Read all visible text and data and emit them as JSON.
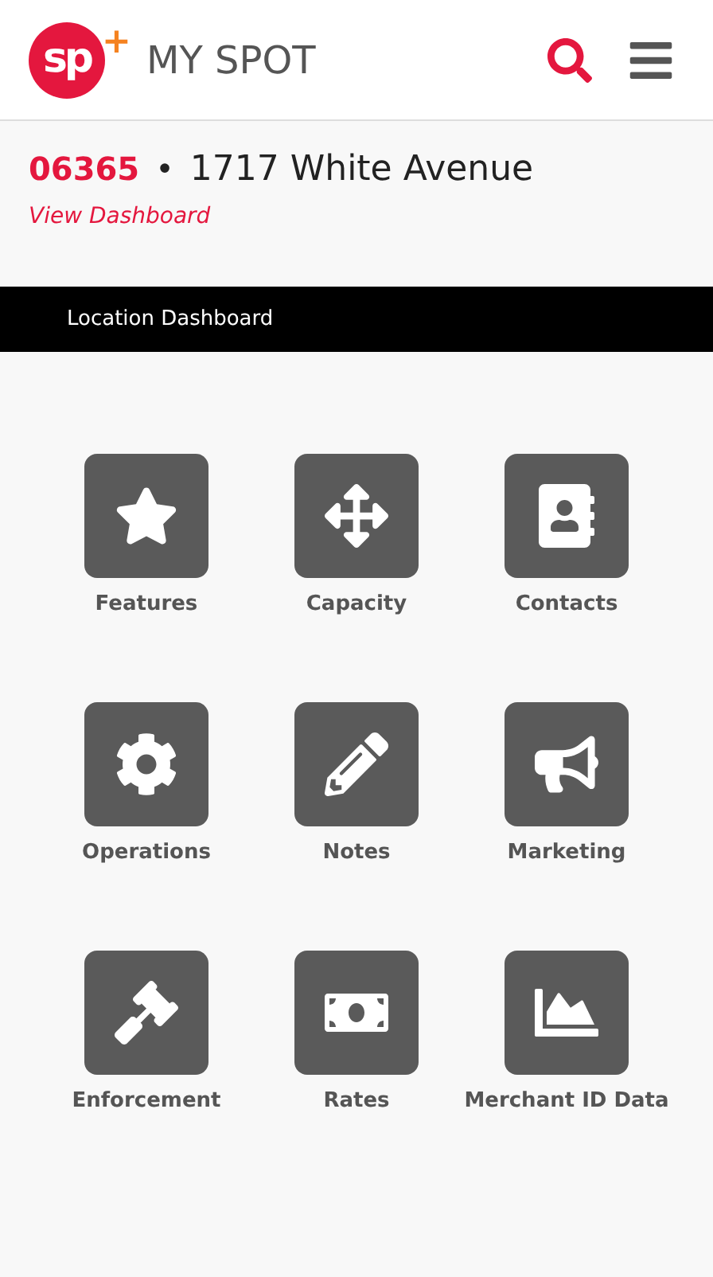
{
  "header": {
    "logo_mark": "sp",
    "logo_plus": "+",
    "app_name": "MY SPOT"
  },
  "location": {
    "number": "06365",
    "separator": "•",
    "address": "1717 White Avenue",
    "link": "View Dashboard"
  },
  "section_bar": {
    "title": "Location Dashboard"
  },
  "tiles": [
    {
      "kind": "star",
      "label": "Features"
    },
    {
      "kind": "move",
      "label": "Capacity"
    },
    {
      "kind": "contacts",
      "label": "Contacts"
    },
    {
      "kind": "gear",
      "label": "Operations"
    },
    {
      "kind": "pencil",
      "label": "Notes"
    },
    {
      "kind": "megaphone",
      "label": "Marketing"
    },
    {
      "kind": "gavel",
      "label": "Enforcement"
    },
    {
      "kind": "money",
      "label": "Rates"
    },
    {
      "kind": "chart",
      "label": "Merchant ID Data"
    }
  ]
}
